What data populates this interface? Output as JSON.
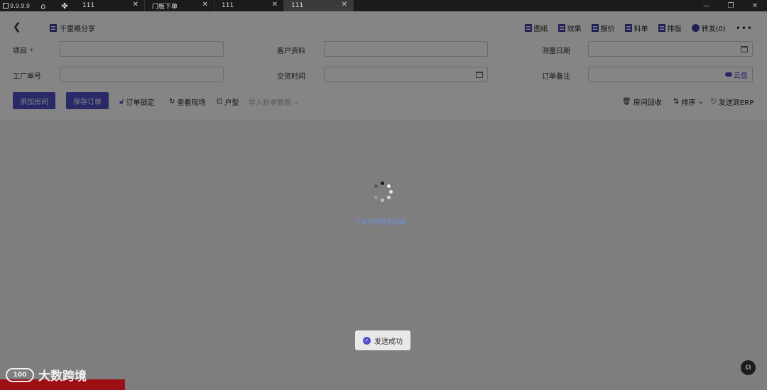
{
  "titlebar": {
    "version": "9.9.9.9",
    "tabs": [
      {
        "label": "111",
        "active": false
      },
      {
        "label": "门板下单",
        "active": false
      },
      {
        "label": "111",
        "active": false
      },
      {
        "label": "111",
        "active": true
      }
    ]
  },
  "header": {
    "share_label": "千里眼分享",
    "buttons": [
      {
        "label": "图纸",
        "icon": "drawing-icon"
      },
      {
        "label": "效果",
        "icon": "render-icon"
      },
      {
        "label": "报价",
        "icon": "quote-icon"
      },
      {
        "label": "料单",
        "icon": "material-list-icon"
      },
      {
        "label": "排版",
        "icon": "layout-icon"
      },
      {
        "label": "转发(0)",
        "icon": "forward-icon"
      }
    ],
    "more_label": "•••"
  },
  "form": {
    "project_label": "项目",
    "project_required": "*",
    "customer_label": "客户资料",
    "measure_date_label": "测量日期",
    "factory_no_label": "工厂单号",
    "delivery_time_label": "交货时间",
    "order_note_label": "订单备注",
    "cloud_label": "云盘"
  },
  "actions": {
    "add_room": "添加房间",
    "save_order": "保存订单",
    "lock_order": "订单锁定",
    "view_site": "查看现场",
    "floor_plan": "户型",
    "import_split": "导入拆单数据",
    "room_recycle": "房间回收",
    "sort": "排序",
    "send_erp": "发送到ERP"
  },
  "loading": {
    "text": "订单详情数据加载..."
  },
  "toast": {
    "text": "发送成功"
  },
  "watermark": {
    "logo": "100",
    "text": "大数跨境"
  },
  "colors": {
    "accent": "#5050c8",
    "required": "#e0443c",
    "loading_text": "#6f8fd8",
    "watermark_bar": "#9d0e15"
  }
}
